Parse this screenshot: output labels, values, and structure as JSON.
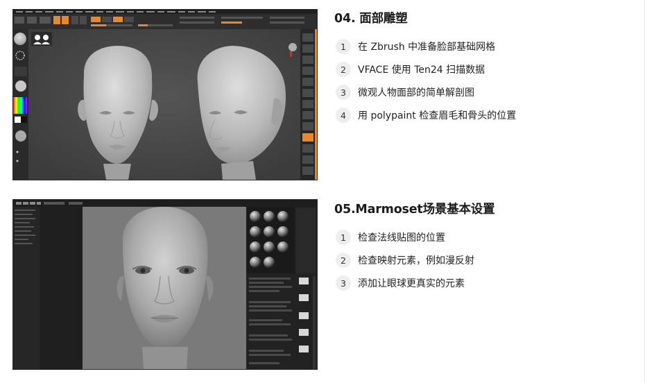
{
  "sections": [
    {
      "title": "04. 面部雕塑",
      "items": [
        {
          "num": "1",
          "text": "在 Zbrush 中准备脸部基础网格"
        },
        {
          "num": "2",
          "text": "VFACE 使用 Ten24 扫描数据"
        },
        {
          "num": "3",
          "text": "微观人物面部的简单解剖图"
        },
        {
          "num": "4",
          "text": "用 polypaint 检查眉毛和骨头的位置"
        }
      ]
    },
    {
      "title": "05.Marmoset场景基本设置",
      "items": [
        {
          "num": "1",
          "text": "检查法线贴图的位置"
        },
        {
          "num": "2",
          "text": "检查映射元素，例如漫反射"
        },
        {
          "num": "3",
          "text": "添加让眼球更真实的元素"
        }
      ]
    }
  ],
  "colors": {
    "accent": "#e8872b",
    "ui_dark": "#2b2b2b",
    "viewport": "#464646"
  }
}
